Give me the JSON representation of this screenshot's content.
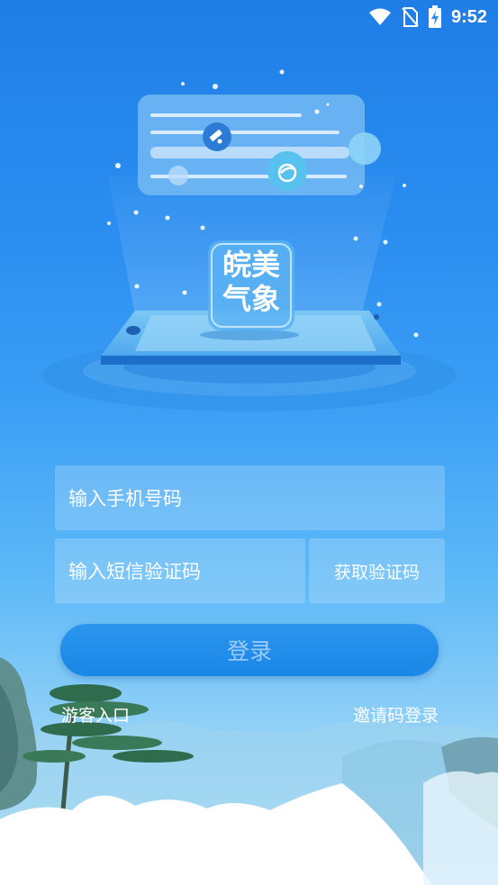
{
  "status_bar": {
    "time": "9:52",
    "icons": [
      "wifi-icon",
      "no-sim-icon",
      "battery-charging-icon"
    ]
  },
  "hero": {
    "logo_line1": "皖美",
    "logo_line2": "气象",
    "icons": [
      "satellite-icon",
      "weather-icon"
    ]
  },
  "form": {
    "phone_placeholder": "输入手机号码",
    "code_placeholder": "输入短信验证码",
    "get_code_label": "获取验证码",
    "login_label": "登录"
  },
  "links": {
    "guest": "游客入口",
    "invite": "邀请码登录"
  },
  "colors": {
    "background_top": "#1f7ee6",
    "background_bottom": "#c6e8f7",
    "login_button": "#1a86e6",
    "text": "#ffffff"
  }
}
